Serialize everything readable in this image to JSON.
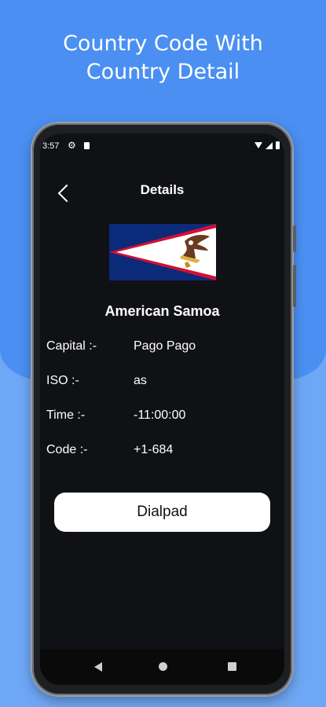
{
  "promo": {
    "title_line1": "Country Code With",
    "title_line2": "Country Detail"
  },
  "status_bar": {
    "time": "3:57",
    "icons": [
      "gear-icon",
      "sd-card-icon",
      "wifi-icon",
      "signal-icon",
      "battery-icon"
    ]
  },
  "header": {
    "back_icon": "chevron-left-icon",
    "title": "Details"
  },
  "country": {
    "flag": "american-samoa-flag",
    "name": "American Samoa"
  },
  "details": [
    {
      "label": "Capital :-",
      "value": "Pago Pago"
    },
    {
      "label": "ISO :-",
      "value": "as"
    },
    {
      "label": "Time :-",
      "value": "-11:00:00"
    },
    {
      "label": "Code :-",
      "value": "+1-684"
    }
  ],
  "actions": {
    "dialpad_label": "Dialpad"
  },
  "nav_bar": {
    "icons": [
      "nav-back-icon",
      "nav-home-icon",
      "nav-recent-icon"
    ]
  },
  "colors": {
    "background_top": "#4a8ff1",
    "background_bottom": "#6ea7f5",
    "screen": "#101114",
    "button": "#ffffff"
  }
}
